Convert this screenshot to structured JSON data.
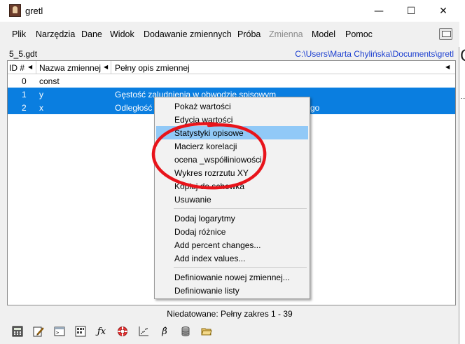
{
  "window": {
    "title": "gretl",
    "controls": {
      "minimize": "—",
      "maximize": "☐",
      "close": "✕"
    }
  },
  "menubar": {
    "items": [
      {
        "label": "Plik",
        "disabled": false
      },
      {
        "label": "Narzędzia",
        "disabled": false
      },
      {
        "label": "Dane",
        "disabled": false
      },
      {
        "label": "Widok",
        "disabled": false
      },
      {
        "label": "Dodawanie zmiennych",
        "disabled": false
      },
      {
        "label": "Próba",
        "disabled": false
      },
      {
        "label": "Zmienna",
        "disabled": true
      },
      {
        "label": "Model",
        "disabled": false
      },
      {
        "label": "Pomoc",
        "disabled": false
      }
    ]
  },
  "file": {
    "name": "5_5.gdt",
    "path": "C:\\Users\\Marta Chylińska\\Documents\\gretl"
  },
  "list": {
    "headers": {
      "id": "ID #",
      "name": "Nazwa zmiennej",
      "desc": "Pełny opis zmiennej"
    },
    "rows": [
      {
        "id": "0",
        "name": "const",
        "desc": "",
        "selected": false
      },
      {
        "id": "1",
        "name": "y",
        "desc": "Gęstość zaludnienia w obwodzie spisowym",
        "selected": true
      },
      {
        "id": "2",
        "name": "x",
        "desc": "Odległość",
        "desc_tail": "go",
        "selected": true
      }
    ]
  },
  "context_menu": {
    "group1": [
      {
        "label": "Pokaż wartości",
        "highlighted": false
      },
      {
        "label": "Edycja wartości",
        "highlighted": false
      },
      {
        "label": "Statystyki opisowe",
        "highlighted": true
      },
      {
        "label": "Macierz korelacji",
        "highlighted": false
      },
      {
        "label": "ocena _współliniowości",
        "highlighted": false
      },
      {
        "label": "Wykres rozrzutu XY",
        "highlighted": false
      },
      {
        "label": "Kopiuj do schowka",
        "highlighted": false
      },
      {
        "label": "Usuwanie",
        "highlighted": false
      }
    ],
    "group2": [
      {
        "label": "Dodaj logarytmy"
      },
      {
        "label": "Dodaj różnice"
      },
      {
        "label": "Add percent changes..."
      },
      {
        "label": "Add index values..."
      }
    ],
    "group3": [
      {
        "label": "Definiowanie nowej zmiennej..."
      },
      {
        "label": "Definiowanie listy"
      }
    ]
  },
  "status": "Niedatowane: Pełny zakres 1 - 39",
  "toolbar": {
    "buttons": [
      {
        "icon": "calculator-icon"
      },
      {
        "icon": "edit-script-icon"
      },
      {
        "icon": "console-icon"
      },
      {
        "icon": "session-icon-view-icon"
      },
      {
        "icon": "function-icon",
        "glyph": "ƒx"
      },
      {
        "icon": "help-lifebuoy-icon"
      },
      {
        "icon": "scatter-plot-icon"
      },
      {
        "icon": "beta-model-icon",
        "glyph": "β̂"
      },
      {
        "icon": "database-icon"
      },
      {
        "icon": "open-folder-icon"
      }
    ]
  },
  "outside_text": "C",
  "colors": {
    "selection": "#0a7ee0",
    "menu_highlight": "#91c9f7",
    "annotation": "#e8141b",
    "path_link": "#1c3fd0"
  }
}
